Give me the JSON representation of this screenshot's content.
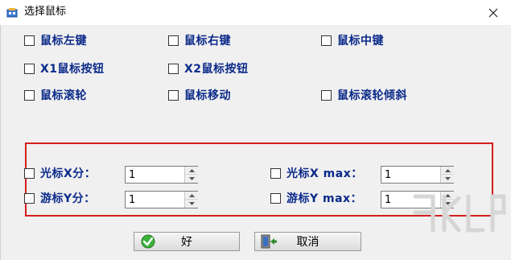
{
  "window": {
    "title": "选择鼠标",
    "close_glyph": "✕"
  },
  "mouse_buttons": [
    {
      "label": "鼠标左键",
      "checked": false
    },
    {
      "label": "鼠标右键",
      "checked": false
    },
    {
      "label": "鼠标中键",
      "checked": false
    },
    {
      "label": "X1鼠标按钮",
      "checked": false
    },
    {
      "label": "X2鼠标按钮",
      "checked": false
    },
    {
      "label": "鼠标滚轮",
      "checked": false
    },
    {
      "label": "鼠标移动",
      "checked": false
    },
    {
      "label": "鼠标滚轮倾斜",
      "checked": false
    }
  ],
  "params": [
    {
      "label": "光标X分：",
      "value": "1",
      "checked": false
    },
    {
      "label": "游标Y分：",
      "value": "1",
      "checked": false
    },
    {
      "label": "光标X max：",
      "value": "1",
      "checked": false
    },
    {
      "label": "游标Y max：",
      "value": "1",
      "checked": false
    }
  ],
  "buttons": {
    "ok": "好",
    "cancel": "取消"
  },
  "colors": {
    "label_text": "#0b2a8a",
    "highlight_border": "#d41e1e"
  },
  "icons": {
    "ok": "checkmark-icon",
    "cancel": "exit-door-icon",
    "close": "close-icon"
  }
}
